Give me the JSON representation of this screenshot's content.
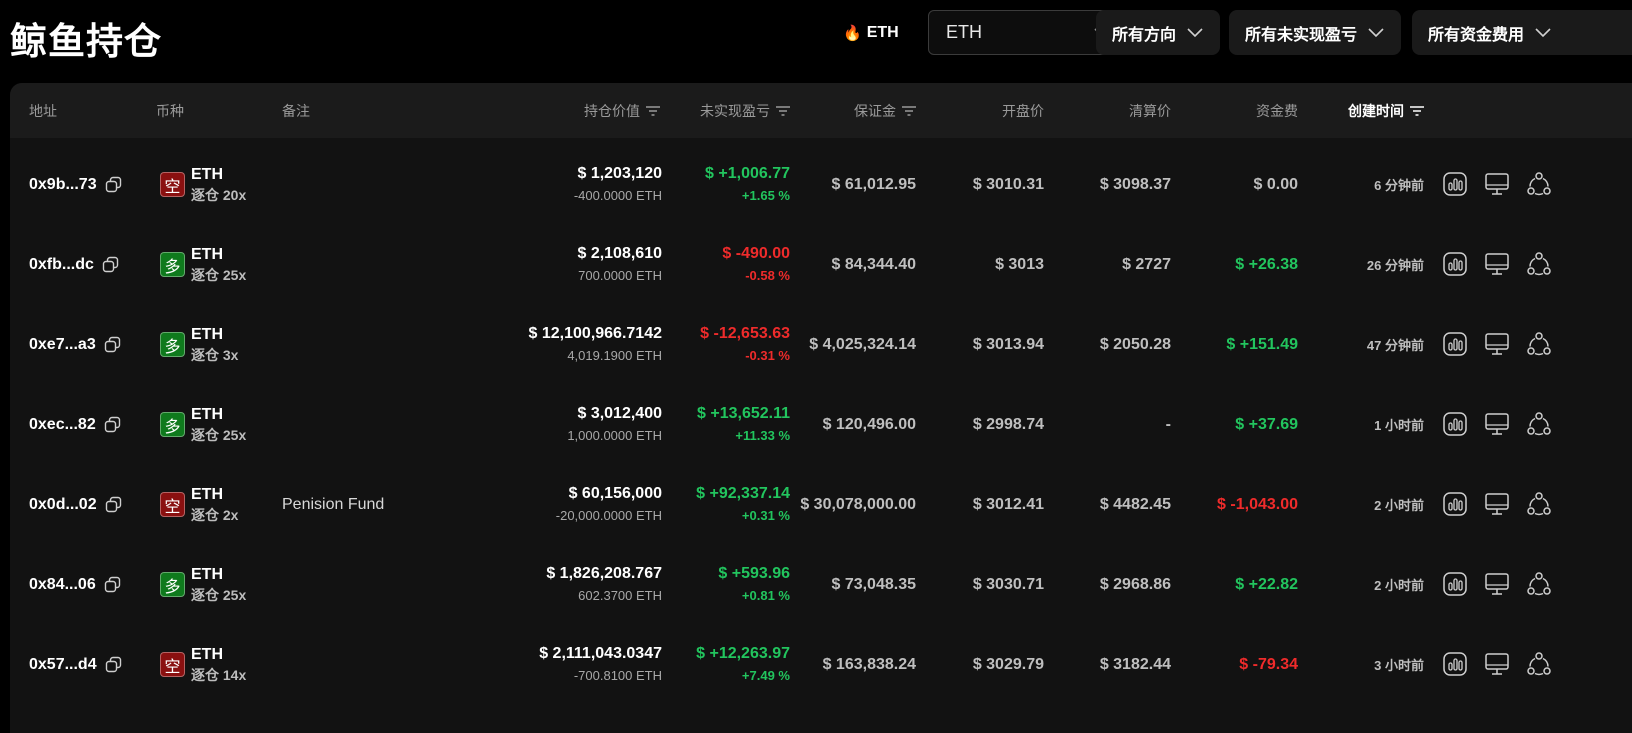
{
  "header": {
    "title": "鲸鱼持仓",
    "hot_label": "ETH",
    "coin_select_value": "ETH",
    "filters": [
      "所有方向",
      "所有未实现盈亏",
      "所有资金费用"
    ]
  },
  "columns": {
    "address": "地址",
    "coin": "币种",
    "note": "备注",
    "value": "持仓价值",
    "pnl": "未实现盈亏",
    "margin": "保证金",
    "entry": "开盘价",
    "liq": "清算价",
    "funding": "资金费",
    "created": "创建时间"
  },
  "rows": [
    {
      "address": "0x9b...73",
      "side": "空",
      "side_type": "short",
      "coin": "ETH",
      "mode": "逐仓 20x",
      "note": "",
      "value": "$ 1,203,120",
      "size": "-400.0000 ETH",
      "pnl": "$ +1,006.77",
      "pnl_pct": "+1.65 %",
      "pnl_sign": "pos",
      "margin": "$ 61,012.95",
      "entry": "$ 3010.31",
      "liq": "$ 3098.37",
      "funding": "$ 0.00",
      "funding_sign": "neutral",
      "created": "6 分钟前"
    },
    {
      "address": "0xfb...dc",
      "side": "多",
      "side_type": "long",
      "coin": "ETH",
      "mode": "逐仓 25x",
      "note": "",
      "value": "$ 2,108,610",
      "size": "700.0000 ETH",
      "pnl": "$ -490.00",
      "pnl_pct": "-0.58 %",
      "pnl_sign": "neg",
      "margin": "$ 84,344.40",
      "entry": "$ 3013",
      "liq": "$ 2727",
      "funding": "$ +26.38",
      "funding_sign": "pos",
      "created": "26 分钟前"
    },
    {
      "address": "0xe7...a3",
      "side": "多",
      "side_type": "long",
      "coin": "ETH",
      "mode": "逐仓 3x",
      "note": "",
      "value": "$ 12,100,966.7142",
      "size": "4,019.1900 ETH",
      "pnl": "$ -12,653.63",
      "pnl_pct": "-0.31 %",
      "pnl_sign": "neg",
      "margin": "$ 4,025,324.14",
      "entry": "$ 3013.94",
      "liq": "$ 2050.28",
      "funding": "$ +151.49",
      "funding_sign": "pos",
      "created": "47 分钟前"
    },
    {
      "address": "0xec...82",
      "side": "多",
      "side_type": "long",
      "coin": "ETH",
      "mode": "逐仓 25x",
      "note": "",
      "value": "$ 3,012,400",
      "size": "1,000.0000 ETH",
      "pnl": "$ +13,652.11",
      "pnl_pct": "+11.33 %",
      "pnl_sign": "pos",
      "margin": "$ 120,496.00",
      "entry": "$ 2998.74",
      "liq": "-",
      "funding": "$ +37.69",
      "funding_sign": "pos",
      "created": "1 小时前"
    },
    {
      "address": "0x0d...02",
      "side": "空",
      "side_type": "short",
      "coin": "ETH",
      "mode": "逐仓 2x",
      "note": "Penision Fund",
      "value": "$ 60,156,000",
      "size": "-20,000.0000 ETH",
      "pnl": "$ +92,337.14",
      "pnl_pct": "+0.31 %",
      "pnl_sign": "pos",
      "margin": "$ 30,078,000.00",
      "entry": "$ 3012.41",
      "liq": "$ 4482.45",
      "funding": "$ -1,043.00",
      "funding_sign": "neg",
      "created": "2 小时前"
    },
    {
      "address": "0x84...06",
      "side": "多",
      "side_type": "long",
      "coin": "ETH",
      "mode": "逐仓 25x",
      "note": "",
      "value": "$ 1,826,208.767",
      "size": "602.3700 ETH",
      "pnl": "$ +593.96",
      "pnl_pct": "+0.81 %",
      "pnl_sign": "pos",
      "margin": "$ 73,048.35",
      "entry": "$ 3030.71",
      "liq": "$ 2968.86",
      "funding": "$ +22.82",
      "funding_sign": "pos",
      "created": "2 小时前"
    },
    {
      "address": "0x57...d4",
      "side": "空",
      "side_type": "short",
      "coin": "ETH",
      "mode": "逐仓 14x",
      "note": "",
      "value": "$ 2,111,043.0347",
      "size": "-700.8100 ETH",
      "pnl": "$ +12,263.97",
      "pnl_pct": "+7.49 %",
      "pnl_sign": "pos",
      "margin": "$ 163,838.24",
      "entry": "$ 3029.79",
      "liq": "$ 3182.44",
      "funding": "$ -79.34",
      "funding_sign": "neg",
      "created": "3 小时前"
    }
  ],
  "colors": {
    "long": "#0f7a1d",
    "short": "#8a1010",
    "positive": "#22c55e",
    "negative": "#ef2b2b",
    "flame": "#ff8a1f"
  },
  "icons": {
    "hot": "flame-icon",
    "copy": "copy-icon",
    "actions": [
      "chart-icon",
      "monitor-icon",
      "share-icon"
    ]
  }
}
